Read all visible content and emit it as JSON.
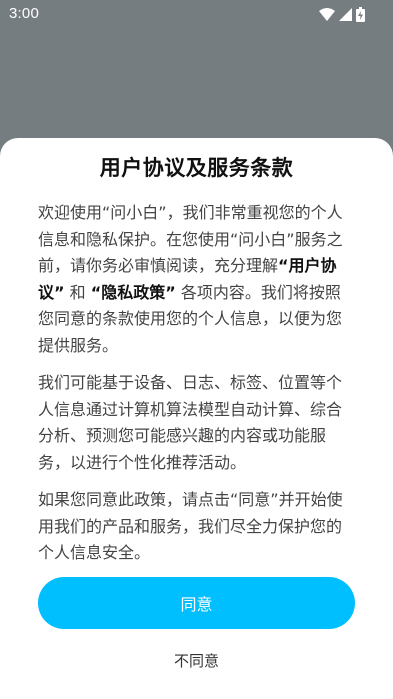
{
  "status_bar": {
    "time": "3:00",
    "icons": [
      "wifi-icon",
      "cell-signal-icon",
      "battery-charging-icon"
    ]
  },
  "dialog": {
    "title": "用户协议及服务条款",
    "para1": {
      "line1": "欢迎使用“问小白”，我们非常重视您的个人信息和隐私保护。在您使用“问小白”服务之前，请你务必审慎阅读，充分理解",
      "user_agreement": "“用户协议”",
      "and": " 和 ",
      "privacy_policy": "“隐私政策”",
      "rest": " 各项内容。我们将按照您同意的条款使用您的个人信息，以便为您提供服务。"
    },
    "para2": "我们可能基于设备、日志、标签、位置等个人信息通过计算机算法模型自动计算、综合分析、预测您可能感兴趣的内容或功能服务，以进行个性化推荐活动。",
    "para3": "如果您同意此政策，请点击“同意”并开始使用我们的产品和服务，我们尽全力保护您的个人信息安全。",
    "agree_label": "同意",
    "disagree_label": "不同意"
  },
  "colors": {
    "backdrop": "#757d80",
    "accent": "#00bfff",
    "sheet": "#ffffff"
  }
}
